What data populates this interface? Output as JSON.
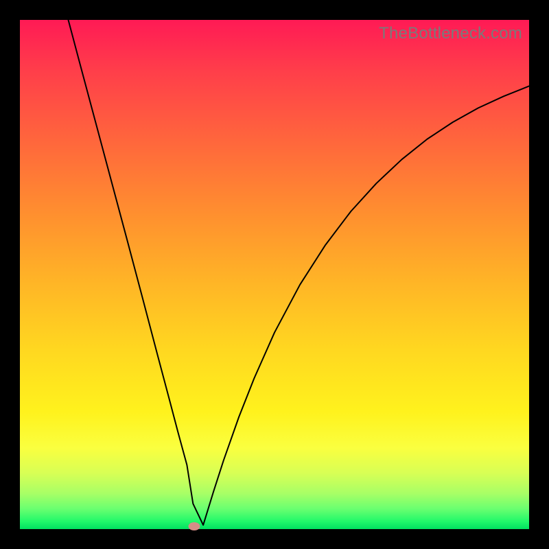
{
  "watermark": "TheBottleneck.com",
  "chart_data": {
    "type": "line",
    "title": "",
    "xlabel": "",
    "ylabel": "",
    "xlim": [
      0,
      100
    ],
    "ylim": [
      0,
      100
    ],
    "grid": false,
    "series": [
      {
        "name": "curve",
        "x": [
          9.5,
          12,
          15,
          18,
          21,
          24,
          27,
          29.5,
          31,
          32.8,
          34,
          36,
          38,
          40,
          43,
          46,
          50,
          55,
          60,
          65,
          70,
          75,
          80,
          85,
          90,
          95,
          100
        ],
        "y": [
          100,
          90.6,
          79.4,
          68.2,
          57.0,
          45.7,
          34.3,
          24.9,
          19.2,
          12.6,
          5.0,
          0.8,
          7.3,
          13.5,
          22.0,
          29.6,
          38.6,
          48.0,
          55.8,
          62.4,
          67.9,
          72.6,
          76.6,
          79.9,
          82.7,
          85.0,
          87.0
        ]
      }
    ],
    "marker": {
      "x": 34.2,
      "y": 0.5,
      "color": "#d58d87"
    }
  }
}
